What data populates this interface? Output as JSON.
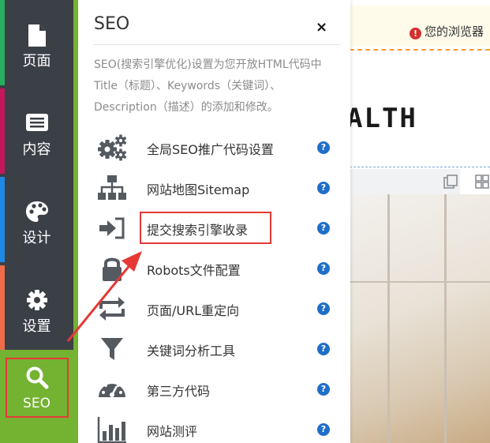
{
  "sidebar": {
    "items": [
      {
        "label": "页面",
        "icon": "page-icon",
        "stripe": "#27ae60"
      },
      {
        "label": "内容",
        "icon": "content-icon",
        "stripe": "#c2185b"
      },
      {
        "label": "设计",
        "icon": "palette-icon",
        "stripe": "#1e88e5"
      },
      {
        "label": "设置",
        "icon": "gear-icon",
        "stripe": "#ef6c4a"
      },
      {
        "label": "SEO",
        "icon": "search-icon",
        "active": true
      }
    ],
    "accent": "#74b232"
  },
  "panel": {
    "title": "SEO",
    "close_label": "×",
    "description": "SEO(搜索引擎优化)设置为您开放HTML代码中Title（标题）、Keywords（关键词）、Description（描述）的添加和修改。",
    "help_label": "?",
    "items": [
      {
        "label": "全局SEO推广代码设置",
        "icon": "gears-icon"
      },
      {
        "label": "网站地图Sitemap",
        "icon": "sitemap-icon"
      },
      {
        "label": "提交搜索引擎收录",
        "icon": "sign-in-icon",
        "highlighted": true
      },
      {
        "label": "Robots文件配置",
        "icon": "lock-icon"
      },
      {
        "label": "页面/URL重定向",
        "icon": "redirect-icon"
      },
      {
        "label": "关键词分析工具",
        "icon": "filter-icon"
      },
      {
        "label": "第三方代码",
        "icon": "dashboard-icon"
      },
      {
        "label": "网站测评",
        "icon": "bar-chart-icon"
      }
    ]
  },
  "preview": {
    "notice_text": "您的浏览器",
    "notice_icon_text": "!",
    "brand_text": "ALTH"
  }
}
